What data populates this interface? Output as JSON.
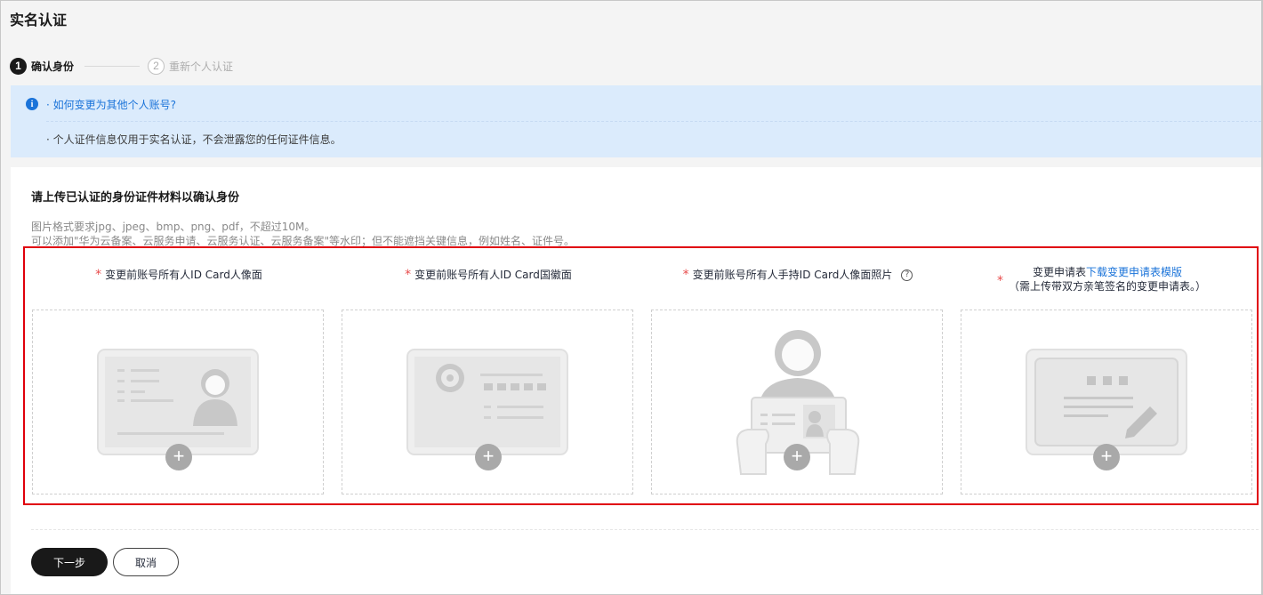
{
  "page": {
    "title": "实名认证"
  },
  "steps": [
    {
      "num": "1",
      "label": "确认身份"
    },
    {
      "num": "2",
      "label": "重新个人认证"
    }
  ],
  "banner": {
    "link": "· 如何变更为其他个人账号?",
    "note": "· 个人证件信息仅用于实名认证，不会泄露您的任何证件信息。",
    "accent": "#1a73d9",
    "background": "#dbebfc"
  },
  "card": {
    "title": "请上传已认证的身份证件材料以确认身份",
    "hint1": "图片格式要求jpg、jpeg、bmp、png、pdf，不超过10M。",
    "hint2": "可以添加\"华为云备案、云服务申请、云服务认证、云服务备案\"等水印；但不能遮挡关键信息，例如姓名、证件号。"
  },
  "uploads": [
    {
      "required": "*",
      "label": "变更前账号所有人ID Card人像面",
      "plus": "+",
      "icon": "id-card-portrait-icon"
    },
    {
      "required": "*",
      "label": "变更前账号所有人ID Card国徽面",
      "plus": "+",
      "icon": "id-card-emblem-icon"
    },
    {
      "required": "*",
      "label": "变更前账号所有人手持ID Card人像面照片",
      "help": "?",
      "plus": "+",
      "icon": "person-holding-card-icon"
    },
    {
      "required": "*",
      "label": "变更申请表",
      "link": "下载变更申请表模版",
      "sub": "（需上传带双方亲笔签名的变更申请表。）",
      "plus": "+",
      "icon": "signed-form-icon"
    }
  ],
  "actions": {
    "next": "下一步",
    "cancel": "取消"
  },
  "colors": {
    "highlight_border": "#e0000b",
    "required": "#e84b4b",
    "primary_button": "#191919"
  }
}
